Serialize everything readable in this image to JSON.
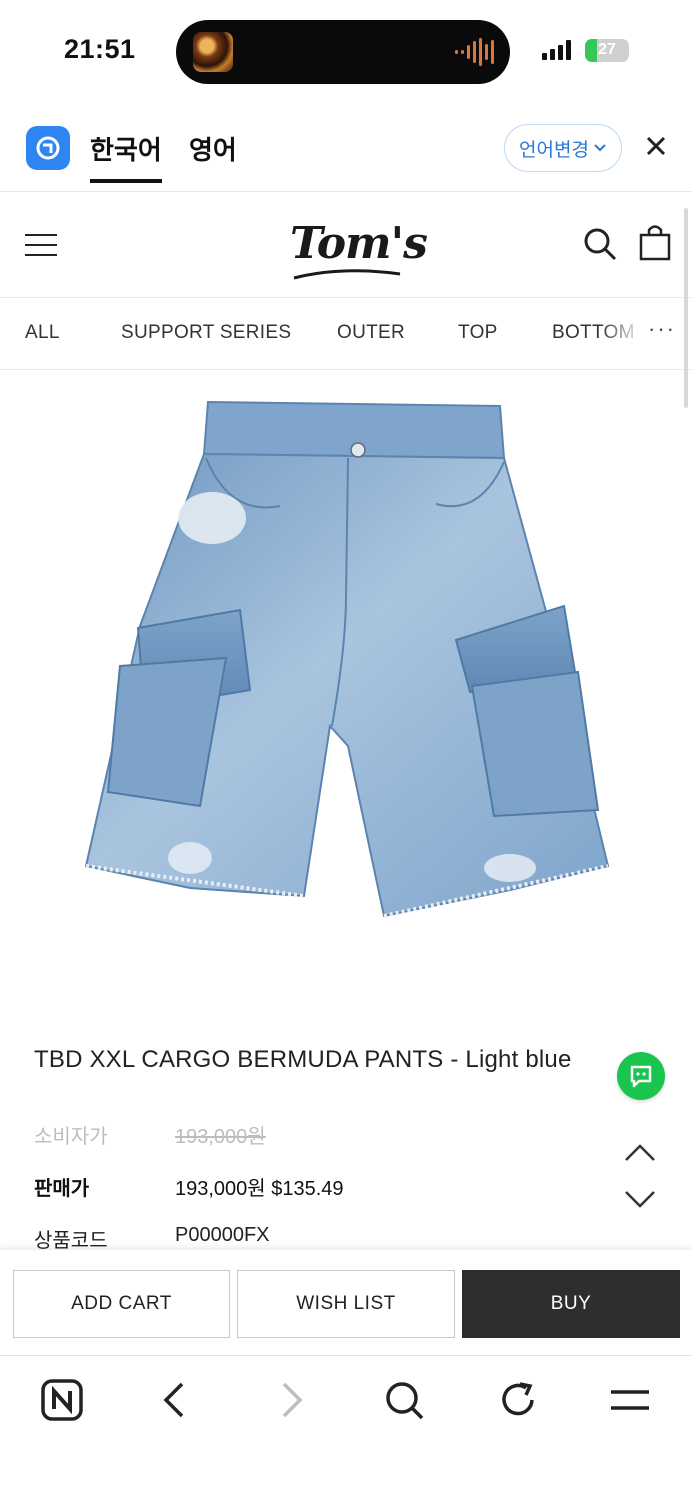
{
  "status_bar": {
    "time": "21:51",
    "battery_level": "27",
    "icons": [
      "cellular-signal-icon",
      "battery-icon",
      "music-waveform-icon"
    ]
  },
  "language_bar": {
    "tabs": [
      {
        "label": "한국어",
        "active": true
      },
      {
        "label": "영어",
        "active": false
      }
    ],
    "change_label": "언어변경",
    "icons": [
      "translator-app-icon",
      "chevron-down-icon",
      "close-icon"
    ]
  },
  "header": {
    "logo_text": "Tom's",
    "icons": [
      "menu-icon",
      "search-icon",
      "shopping-bag-icon"
    ]
  },
  "categories": {
    "items": [
      {
        "label": "ALL"
      },
      {
        "label": "SUPPORT SERIES"
      },
      {
        "label": "OUTER"
      },
      {
        "label": "TOP"
      },
      {
        "label": "BOTTOM"
      }
    ],
    "more_label": "···"
  },
  "product": {
    "image_alt": "Light blue denim cargo bermuda shorts",
    "title": "TBD XXL CARGO BERMUDA PANTS - Light blue",
    "rows": [
      {
        "label": "소비자가",
        "value": "193,000원"
      },
      {
        "label": "판매가",
        "value": "193,000원 $135.49"
      },
      {
        "label": "상품코드",
        "value": "P00000FX"
      }
    ]
  },
  "actions": {
    "add_cart": "ADD CART",
    "wish_list": "WISH LIST",
    "buy": "BUY"
  },
  "browser_toolbar": {
    "icons": [
      "naver-home-icon",
      "back-icon",
      "forward-icon",
      "search-icon",
      "refresh-icon",
      "menu-icon"
    ]
  },
  "colors": {
    "brand_blue": "#2f86f2",
    "chat_green": "#19c44f",
    "buy_button": "#2e2e2e",
    "strike_text": "#bdbdbd"
  }
}
